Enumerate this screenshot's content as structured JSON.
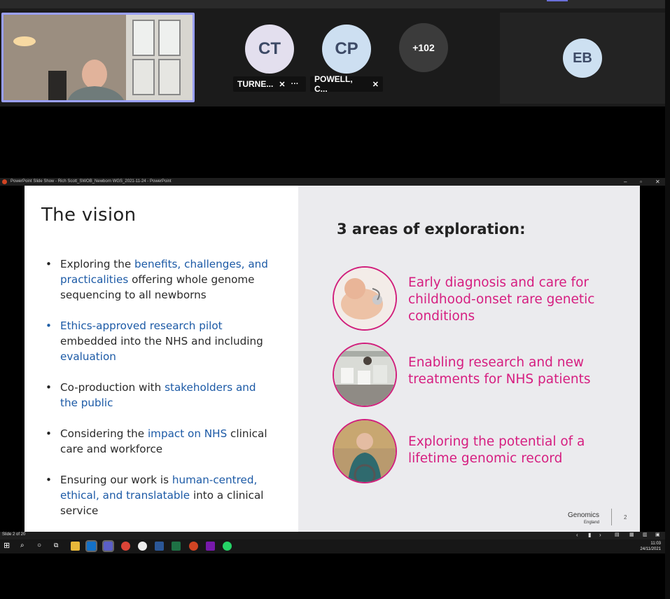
{
  "meeting": {
    "participants": [
      {
        "initials": "CT",
        "name": "TURNE...",
        "muted": true
      },
      {
        "initials": "CP",
        "name": "POWELL, C...",
        "muted": true
      },
      {
        "initials": "+102"
      },
      {
        "initials": "EB"
      }
    ]
  },
  "window": {
    "title": "PowerPoint Slide Show  -  Rich Scott_SWOB_Newborn WGS_2021-11-24 - PowerPoint"
  },
  "slide": {
    "title": "The vision",
    "bullets": [
      {
        "segments": [
          {
            "t": "Exploring the ",
            "hl": false
          },
          {
            "t": "benefits, challenges, and practicalities",
            "hl": true
          },
          {
            "t": " offering whole genome sequencing to all newborns",
            "hl": false
          }
        ]
      },
      {
        "segments": [
          {
            "t": "Ethics-approved research pilot",
            "hl": true
          },
          {
            "t": " embedded into the NHS and including ",
            "hl": false
          },
          {
            "t": "evaluation",
            "hl": true
          }
        ],
        "blue_bullet": true
      },
      {
        "segments": [
          {
            "t": "Co-production with ",
            "hl": false
          },
          {
            "t": "stakeholders and the public",
            "hl": true
          }
        ]
      },
      {
        "segments": [
          {
            "t": "Considering the ",
            "hl": false
          },
          {
            "t": "impact on NHS",
            "hl": true
          },
          {
            "t": " clinical care and workforce",
            "hl": false
          }
        ]
      },
      {
        "segments": [
          {
            "t": "Ensuring our work is ",
            "hl": false
          },
          {
            "t": "human-centred, ethical, and translatable",
            "hl": true
          },
          {
            "t": " into a clinical service",
            "hl": false
          }
        ]
      }
    ],
    "areas_title": "3 areas of exploration:",
    "areas": [
      {
        "text": "Early diagnosis and care for childhood-onset rare genetic conditions"
      },
      {
        "text": "Enabling research and new treatments for NHS patients"
      },
      {
        "text": "Exploring the potential of a lifetime genomic record"
      }
    ],
    "logo": "Genomics",
    "logo_sub": "England",
    "page_number": "2"
  },
  "status": {
    "slide_counter": "Slide 2 of 20"
  },
  "clock": {
    "time": "11:03",
    "date": "24/11/2021"
  },
  "colors": {
    "highlight_blue": "#1c5aa6",
    "accent_magenta": "#d61e80",
    "active_speaker_border": "#9aa0ff"
  }
}
